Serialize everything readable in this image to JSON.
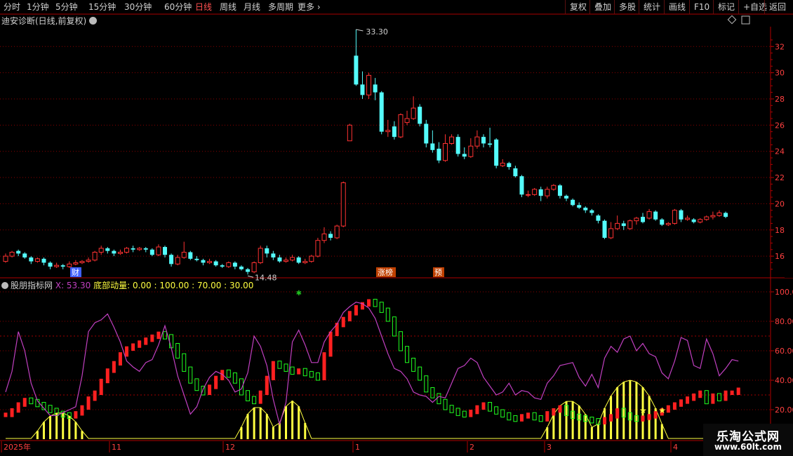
{
  "toolbar": {
    "periods": [
      {
        "label": "分时",
        "active": false
      },
      {
        "label": "1分钟",
        "active": false
      },
      {
        "label": "5分钟",
        "active": false
      },
      {
        "label": "15分钟",
        "active": false
      },
      {
        "label": "30分钟",
        "active": false
      },
      {
        "label": "60分钟",
        "active": false
      },
      {
        "label": "日线",
        "active": true
      },
      {
        "label": "周线",
        "active": false
      },
      {
        "label": "月线",
        "active": false
      },
      {
        "label": "多周期",
        "active": false
      },
      {
        "label": "更多",
        "active": false
      }
    ],
    "more_arrow": "›",
    "right_buttons": [
      "复权",
      "叠加",
      "多股",
      "统计",
      "画线",
      "F10",
      "标记",
      "+自选",
      "返回"
    ]
  },
  "main_chart": {
    "title": "迪安诊断(日线,前复权)",
    "price_ticks": [
      "32.00",
      "30.00",
      "28.00",
      "26.00",
      "24.00",
      "22.00",
      "20.00",
      "18.00",
      "16.00"
    ],
    "high_label": "33.30",
    "low_label": "14.48",
    "markers": [
      {
        "text": "财"
      },
      {
        "text": "涨榜"
      },
      {
        "text": "预"
      }
    ]
  },
  "indicator": {
    "name": "股朋指标网",
    "x_text": "X: 53.30",
    "bottom_text": "底部动量: 0.00 : 100.00 : 70.00 : 30.00",
    "ticks": [
      "100.0",
      "80.00",
      "60.00",
      "40.00",
      "20.00"
    ]
  },
  "x_axis": {
    "labels": [
      "2025年",
      "11",
      "12",
      "1",
      "2",
      "3",
      "4"
    ]
  },
  "colors": {
    "up": "#ff3232",
    "down": "#54fcfc",
    "grid": "#8b0000",
    "axis_text": "#ff4040",
    "line": "#c040c0",
    "bar_red": "#ff2020",
    "bar_green": "#20ff20",
    "yellow": "#ffff40"
  },
  "chart_data": {
    "type": "candlestick",
    "y_unit": "price",
    "ylim": [
      14.4,
      33.3
    ],
    "high": 33.3,
    "low": 14.48,
    "candles": [
      [
        15.6,
        16.0,
        16.2,
        15.5
      ],
      [
        16.0,
        16.3,
        16.4,
        15.9
      ],
      [
        16.4,
        16.2,
        16.5,
        16.0
      ],
      [
        16.2,
        15.9,
        16.3,
        15.8
      ],
      [
        15.9,
        15.6,
        16.0,
        15.4
      ],
      [
        15.6,
        15.8,
        15.9,
        15.5
      ],
      [
        15.8,
        15.5,
        15.9,
        15.3
      ],
      [
        15.5,
        15.2,
        15.6,
        15.0
      ],
      [
        15.2,
        15.3,
        15.5,
        15.1
      ],
      [
        15.3,
        15.2,
        15.4,
        15.0
      ],
      [
        15.2,
        15.4,
        15.6,
        15.1
      ],
      [
        15.4,
        15.5,
        15.7,
        15.3
      ],
      [
        15.5,
        15.6,
        15.7,
        15.4
      ],
      [
        15.6,
        15.7,
        15.9,
        15.5
      ],
      [
        15.7,
        16.3,
        16.4,
        15.6
      ],
      [
        16.3,
        16.6,
        16.8,
        16.1
      ],
      [
        16.6,
        16.4,
        16.7,
        16.2
      ],
      [
        16.4,
        16.2,
        16.5,
        16.0
      ],
      [
        16.2,
        16.3,
        16.5,
        16.1
      ],
      [
        16.3,
        16.6,
        16.7,
        16.2
      ],
      [
        16.6,
        16.5,
        16.8,
        16.3
      ],
      [
        16.5,
        16.6,
        16.7,
        16.4
      ],
      [
        16.6,
        16.5,
        16.7,
        16.3
      ],
      [
        16.5,
        16.1,
        16.6,
        16.0
      ],
      [
        16.1,
        16.7,
        16.9,
        16.0
      ],
      [
        16.7,
        16.1,
        16.8,
        15.9
      ],
      [
        16.1,
        15.4,
        16.2,
        15.2
      ],
      [
        15.4,
        15.9,
        16.1,
        15.3
      ],
      [
        15.9,
        16.3,
        17.1,
        15.8
      ],
      [
        16.3,
        15.8,
        16.4,
        15.7
      ],
      [
        15.8,
        15.7,
        16.0,
        15.6
      ],
      [
        15.7,
        15.5,
        15.8,
        15.3
      ],
      [
        15.5,
        15.6,
        15.8,
        15.4
      ],
      [
        15.6,
        15.3,
        15.7,
        15.2
      ],
      [
        15.3,
        15.2,
        15.4,
        15.1
      ],
      [
        15.2,
        15.5,
        15.6,
        15.1
      ],
      [
        15.5,
        15.2,
        15.6,
        15.0
      ],
      [
        15.2,
        15.0,
        15.3,
        14.9
      ],
      [
        15.0,
        14.8,
        15.1,
        14.6
      ],
      [
        14.8,
        15.5,
        15.6,
        14.7
      ],
      [
        15.5,
        16.6,
        16.8,
        15.4
      ],
      [
        16.6,
        16.2,
        16.8,
        15.9
      ],
      [
        16.2,
        15.9,
        16.4,
        15.7
      ],
      [
        15.9,
        15.6,
        16.1,
        15.5
      ],
      [
        15.6,
        15.7,
        15.9,
        15.5
      ],
      [
        15.7,
        15.9,
        16.1,
        15.6
      ],
      [
        15.9,
        15.5,
        16.0,
        15.4
      ],
      [
        15.5,
        15.6,
        15.8,
        15.4
      ],
      [
        15.6,
        16.0,
        16.1,
        15.5
      ],
      [
        16.0,
        17.2,
        17.4,
        15.9
      ],
      [
        17.2,
        17.7,
        18.2,
        17.0
      ],
      [
        17.7,
        17.4,
        17.9,
        17.2
      ],
      [
        17.4,
        18.3,
        18.4,
        17.3
      ],
      [
        18.3,
        21.6,
        21.7,
        18.2
      ],
      [
        24.8,
        26.0,
        26.1,
        24.8
      ],
      [
        31.3,
        29.1,
        33.3,
        29.0
      ],
      [
        29.1,
        28.3,
        30.1,
        28.0
      ],
      [
        28.3,
        29.8,
        30.0,
        28.0
      ],
      [
        29.1,
        28.5,
        29.6,
        27.9
      ],
      [
        28.5,
        25.5,
        28.6,
        25.3
      ],
      [
        25.5,
        25.6,
        26.4,
        25.1
      ],
      [
        25.9,
        25.1,
        26.3,
        24.9
      ],
      [
        25.1,
        26.8,
        26.9,
        25.0
      ],
      [
        26.2,
        26.5,
        27.1,
        26.0
      ],
      [
        26.5,
        27.3,
        28.2,
        26.4
      ],
      [
        27.4,
        26.1,
        27.6,
        25.9
      ],
      [
        26.1,
        24.6,
        26.4,
        24.3
      ],
      [
        24.6,
        24.1,
        25.6,
        23.9
      ],
      [
        24.2,
        23.3,
        24.7,
        23.1
      ],
      [
        23.3,
        24.6,
        25.3,
        23.2
      ],
      [
        24.6,
        25.1,
        25.3,
        24.5
      ],
      [
        25.1,
        23.8,
        25.3,
        23.6
      ],
      [
        23.8,
        23.6,
        24.3,
        23.4
      ],
      [
        23.6,
        24.4,
        25.0,
        23.5
      ],
      [
        24.4,
        25.1,
        25.6,
        24.2
      ],
      [
        25.1,
        24.6,
        25.3,
        24.3
      ],
      [
        24.6,
        24.5,
        25.8,
        24.3
      ],
      [
        24.9,
        22.9,
        25.0,
        22.7
      ],
      [
        22.9,
        23.1,
        23.4,
        22.8
      ],
      [
        23.1,
        22.8,
        23.2,
        22.6
      ],
      [
        22.7,
        22.1,
        22.9,
        22.0
      ],
      [
        22.1,
        20.7,
        22.2,
        20.5
      ],
      [
        20.7,
        20.7,
        21.0,
        20.5
      ],
      [
        20.7,
        21.1,
        21.2,
        20.6
      ],
      [
        21.1,
        20.6,
        21.3,
        20.2
      ],
      [
        20.6,
        21.1,
        21.3,
        20.4
      ],
      [
        21.1,
        21.4,
        21.5,
        21.0
      ],
      [
        21.4,
        20.6,
        21.5,
        20.4
      ],
      [
        20.6,
        20.4,
        20.7,
        20.2
      ],
      [
        20.3,
        19.9,
        20.4,
        19.8
      ],
      [
        19.9,
        19.7,
        20.1,
        19.6
      ],
      [
        19.7,
        19.5,
        19.8,
        19.3
      ],
      [
        19.5,
        19.3,
        19.6,
        19.1
      ],
      [
        19.1,
        18.7,
        19.2,
        18.5
      ],
      [
        18.7,
        17.4,
        18.8,
        17.3
      ],
      [
        17.4,
        18.1,
        18.6,
        17.3
      ],
      [
        18.1,
        18.5,
        19.1,
        18.0
      ],
      [
        18.5,
        18.3,
        18.7,
        18.0
      ],
      [
        18.1,
        18.7,
        18.8,
        18.0
      ],
      [
        18.7,
        18.9,
        19.0,
        18.4
      ],
      [
        19.0,
        18.6,
        19.3,
        18.5
      ],
      [
        18.9,
        19.4,
        19.6,
        18.8
      ],
      [
        19.4,
        18.8,
        19.5,
        18.7
      ],
      [
        18.8,
        18.4,
        18.9,
        18.3
      ],
      [
        18.4,
        18.5,
        18.6,
        18.3
      ],
      [
        18.5,
        19.5,
        19.6,
        18.4
      ],
      [
        19.5,
        18.8,
        19.6,
        18.6
      ],
      [
        18.8,
        18.9,
        19.1,
        18.7
      ],
      [
        18.8,
        18.6,
        18.9,
        18.5
      ],
      [
        18.6,
        18.8,
        18.9,
        18.5
      ],
      [
        18.8,
        19.0,
        19.1,
        18.7
      ],
      [
        19.0,
        19.1,
        19.4,
        18.8
      ],
      [
        19.1,
        19.3,
        19.5,
        19.0
      ],
      [
        19.3,
        19.0,
        19.4,
        18.9
      ]
    ],
    "indicator_line": [
      32,
      46,
      73,
      60,
      38,
      26,
      21,
      16,
      16,
      18,
      20,
      22,
      43,
      73,
      79,
      81,
      85,
      76,
      66,
      53,
      49,
      46,
      52,
      54,
      64,
      77,
      62,
      43,
      30,
      17,
      22,
      34,
      42,
      46,
      44,
      40,
      32,
      34,
      45,
      70,
      63,
      50,
      27,
      10,
      25,
      66,
      74,
      64,
      52,
      52,
      66,
      73,
      78,
      86,
      90,
      93,
      92,
      89,
      82,
      70,
      58,
      48,
      46,
      41,
      32,
      30,
      29,
      25,
      29,
      28,
      38,
      48,
      50,
      55,
      52,
      42,
      36,
      30,
      32,
      38,
      30,
      33,
      32,
      28,
      27,
      38,
      43,
      50,
      51,
      52,
      42,
      36,
      44,
      35,
      55,
      63,
      59,
      68,
      70,
      60,
      65,
      58,
      56,
      45,
      41,
      53,
      69,
      67,
      50,
      48,
      68,
      58,
      43,
      48,
      54,
      53
    ],
    "momentum_bars": [
      0,
      0,
      0,
      8,
      15,
      18,
      18,
      11,
      5,
      3,
      3,
      1,
      0,
      0,
      0,
      0,
      0,
      0,
      0,
      0,
      0,
      0,
      0,
      0,
      0,
      0,
      0,
      0,
      0,
      0,
      0,
      0,
      0,
      0,
      0,
      0,
      0,
      0,
      0,
      0,
      0,
      0,
      0,
      0,
      0,
      0,
      0,
      0,
      0,
      0,
      0,
      0,
      0,
      0,
      0,
      0,
      0,
      0,
      0,
      0,
      0,
      0,
      0,
      0,
      0,
      0,
      0,
      0,
      0,
      0,
      0,
      0,
      0,
      0,
      0,
      0,
      0,
      0,
      0,
      0,
      0,
      0,
      0,
      0,
      0,
      0,
      0,
      0,
      0,
      0,
      0,
      0,
      0,
      0,
      0,
      0,
      0,
      0,
      0,
      0,
      0,
      0,
      0,
      0,
      0,
      0,
      0,
      0,
      0,
      0,
      0,
      0,
      0,
      0,
      0,
      0
    ]
  }
}
